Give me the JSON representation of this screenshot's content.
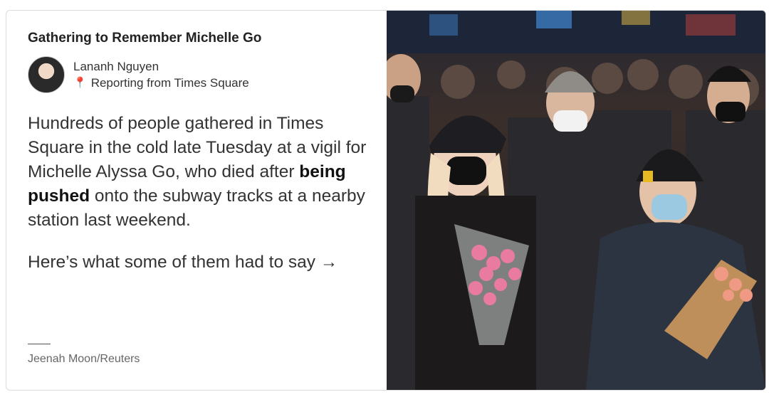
{
  "headline": "Gathering to Remember Michelle Go",
  "byline": {
    "author": "Lananh Nguyen",
    "location": "Reporting from Times Square",
    "location_icon": "map-pin-icon"
  },
  "summary": {
    "part1": "Hundreds of people gathered in Times Square in the cold late Tuesday at a vigil for Michelle Alyssa Go, who died after ",
    "bold": "being pushed",
    "part2": " onto the subway tracks at a nearby station last weekend."
  },
  "cta": "Here’s what some of them had to say →",
  "photo_credit": "Jeenah Moon/Reuters",
  "colors": {
    "text": "#333333",
    "pin": "#d0021b",
    "border": "#dcdcdc"
  }
}
